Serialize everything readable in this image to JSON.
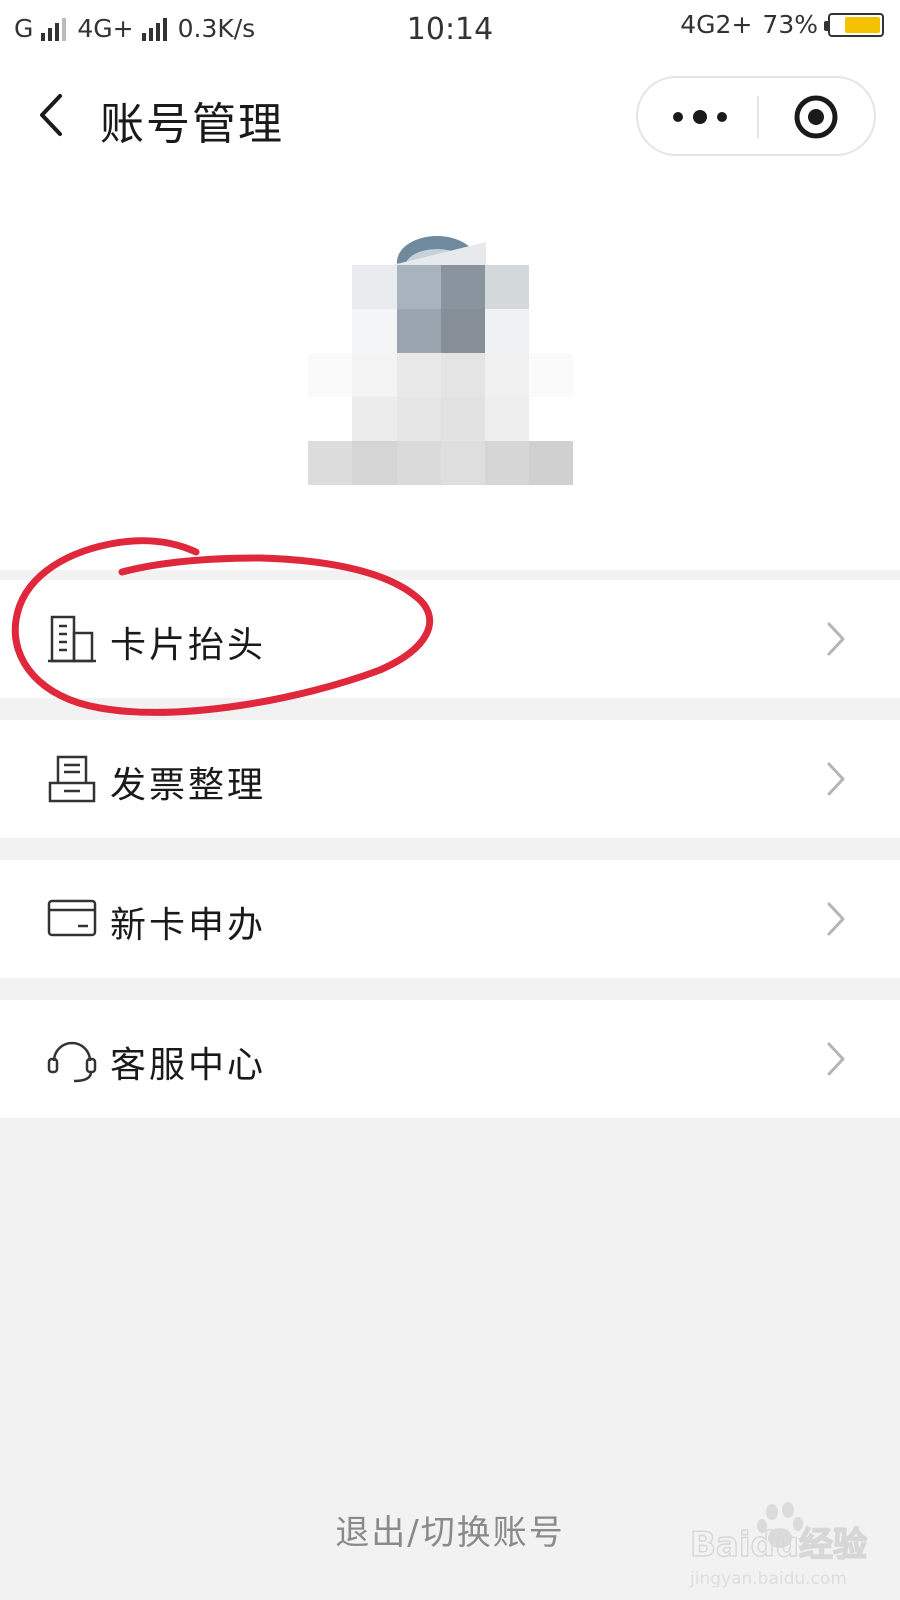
{
  "status_bar": {
    "sim1": "G",
    "sim2": "4G+",
    "speed": "0.3K/s",
    "time": "10:14",
    "network": "4G2+",
    "battery": "73%",
    "battery_level": 0.73,
    "battery_color": "#f5c200"
  },
  "nav": {
    "title": "账号管理",
    "back_icon": "chevron-left-icon",
    "more_icon": "more-dots-icon",
    "close_icon": "target-close-icon"
  },
  "menu": [
    {
      "label": "卡片抬头",
      "icon": "building-icon"
    },
    {
      "label": "发票整理",
      "icon": "invoice-tray-icon"
    },
    {
      "label": "新卡申办",
      "icon": "card-icon"
    },
    {
      "label": "客服中心",
      "icon": "headset-icon"
    }
  ],
  "annotation_color": "#e0283c",
  "logout_label": "退出/切换账号",
  "watermark": {
    "brand": "Baidu经验",
    "url": "jingyan.baidu.com"
  }
}
